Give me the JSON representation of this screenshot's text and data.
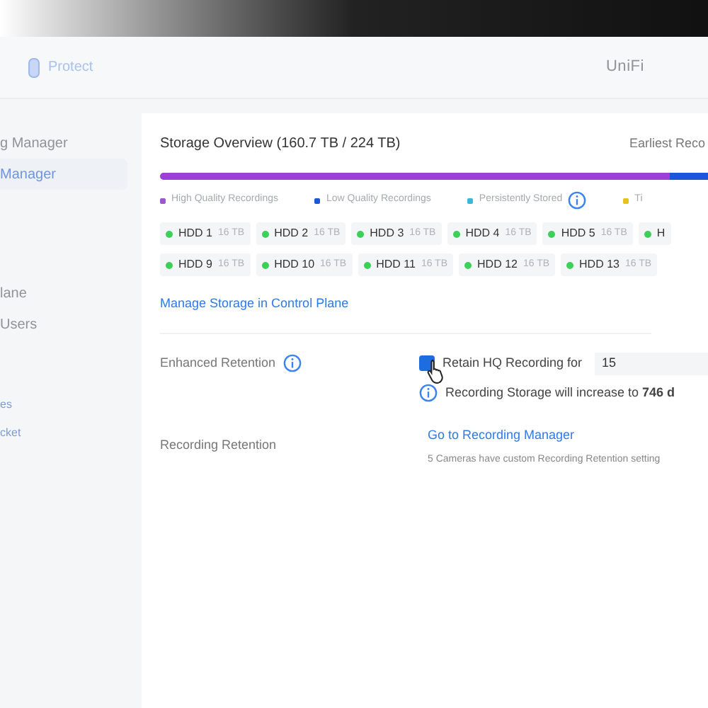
{
  "header": {
    "app": "Protect",
    "brand": "UniFi"
  },
  "sidebar": {
    "items": [
      {
        "label": "g Manager",
        "selected": false
      },
      {
        "label": "Manager",
        "selected": true
      },
      {
        "label": "lane",
        "selected": false
      },
      {
        "label": "Users",
        "selected": false
      }
    ],
    "footer_links": [
      "es",
      "cket"
    ]
  },
  "storage": {
    "title": "Storage Overview (160.7 TB / 224 TB)",
    "earliest": "Earliest Reco",
    "segments": [
      {
        "color": "#9b3fd6",
        "level": 0.93
      },
      {
        "color": "#1a56d6",
        "level": 0.07
      }
    ],
    "legend": [
      {
        "label": "High Quality Recordings",
        "color": "#9b59d0",
        "info": false
      },
      {
        "label": "Low Quality Recordings",
        "color": "#1a56d6",
        "info": false
      },
      {
        "label": "Persistently Stored",
        "color": "#3bb8d8",
        "info": true
      },
      {
        "label": "Ti",
        "color": "#e8c21a",
        "info": false
      }
    ],
    "disks": [
      [
        {
          "name": "HDD 1",
          "size": "16 TB"
        },
        {
          "name": "HDD 2",
          "size": "16 TB"
        },
        {
          "name": "HDD 3",
          "size": "16 TB"
        },
        {
          "name": "HDD 4",
          "size": "16 TB"
        },
        {
          "name": "HDD 5",
          "size": "16 TB"
        },
        {
          "name": "H"
        }
      ],
      [
        {
          "name": "HDD 9",
          "size": "16 TB"
        },
        {
          "name": "HDD 10",
          "size": "16 TB"
        },
        {
          "name": "HDD 11",
          "size": "16 TB"
        },
        {
          "name": "HDD 12",
          "size": "16 TB"
        },
        {
          "name": "HDD 13",
          "size": "16 TB"
        }
      ]
    ],
    "manage_link": "Manage Storage in Control Plane"
  },
  "enhanced": {
    "label": "Enhanced Retention",
    "checked": true,
    "checkbox_label": "Retain HQ Recording for",
    "days": "15",
    "note": "Recording Storage will increase to **746 d**"
  },
  "retention": {
    "label": "Recording Retention",
    "link": "Go to Recording Manager",
    "note": "5 Cameras have custom Recording Retention setting"
  }
}
